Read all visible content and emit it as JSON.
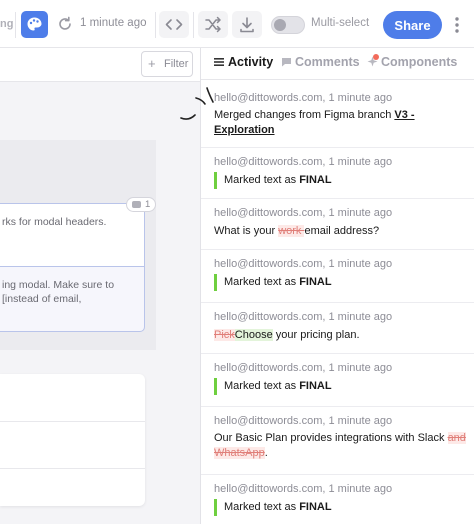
{
  "toolbar": {
    "cut_label": "ng",
    "last_edit": "1 minute ago",
    "multiselect_label": "Multi-select",
    "share_label": "Share"
  },
  "left": {
    "filter_label": "Filter",
    "comment_count": "1",
    "card1_text": "rks for modal headers.",
    "card2_line1": "ing modal. Make sure to",
    "card2_line2": "[instead of email,"
  },
  "tabs": {
    "activity": "Activity",
    "comments": "Comments",
    "components": "Components"
  },
  "activity": [
    {
      "meta": "hello@dittowords.com, 1 minute ago",
      "text": "Merged changes from Figma branch ",
      "link_line1": "V3 -",
      "link_line2": "Exploration"
    },
    {
      "meta": "hello@dittowords.com, 1 minute ago",
      "prefix": "Marked text as ",
      "status": "FINAL"
    },
    {
      "meta": "hello@dittowords.com, 1 minute ago",
      "before": "What is your ",
      "deleted": "work ",
      "after": "email address?"
    },
    {
      "meta": "hello@dittowords.com, 1 minute ago",
      "prefix": "Marked text as ",
      "status": "FINAL"
    },
    {
      "meta": "hello@dittowords.com, 1 minute ago",
      "deleted": "Pick",
      "inserted": "Choose",
      "after": " your pricing plan."
    },
    {
      "meta": "hello@dittowords.com, 1 minute ago",
      "prefix": "Marked text as ",
      "status": "FINAL"
    },
    {
      "meta": "hello@dittowords.com, 1 minute ago",
      "before": "Our Basic Plan provides integrations with Slack ",
      "deleted1": "and",
      "deleted2": "WhatsApp",
      "after": "."
    },
    {
      "meta": "hello@dittowords.com, 1 minute ago",
      "prefix": "Marked text as ",
      "status": "FINAL"
    }
  ],
  "colors": {
    "accent": "#4e7de9",
    "final_bar": "#6fcf3f",
    "notification_dot": "#f26b5b"
  }
}
